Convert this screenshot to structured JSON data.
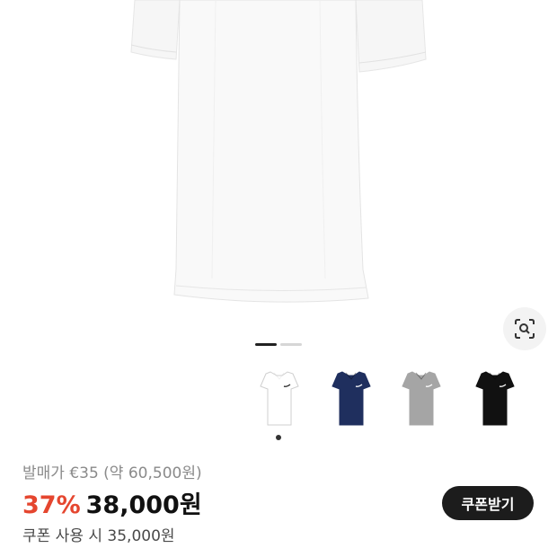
{
  "product": {
    "main_image": "white-polo-shirt",
    "variants": [
      {
        "name": "white",
        "color": "#ffffff",
        "logo_color": "#222222"
      },
      {
        "name": "navy",
        "color": "#1f2f5e",
        "logo_color": "#ffffff"
      },
      {
        "name": "grey",
        "color": "#a5a5a5",
        "logo_color": "#ffffff"
      },
      {
        "name": "black",
        "color": "#111111",
        "logo_color": "#ffffff"
      }
    ],
    "selected_variant": 0,
    "image_page_current": 1,
    "image_page_total": 2
  },
  "pricing": {
    "original": "발매가 €35 (약 60,500원)",
    "discount": "37%",
    "price": "38,000원",
    "coupon_note": "쿠폰 사용 시 35,000원",
    "coupon_button": "쿠폰받기",
    "discount_color": "#e5462f"
  },
  "icons": {
    "lens": "image-search-icon"
  }
}
